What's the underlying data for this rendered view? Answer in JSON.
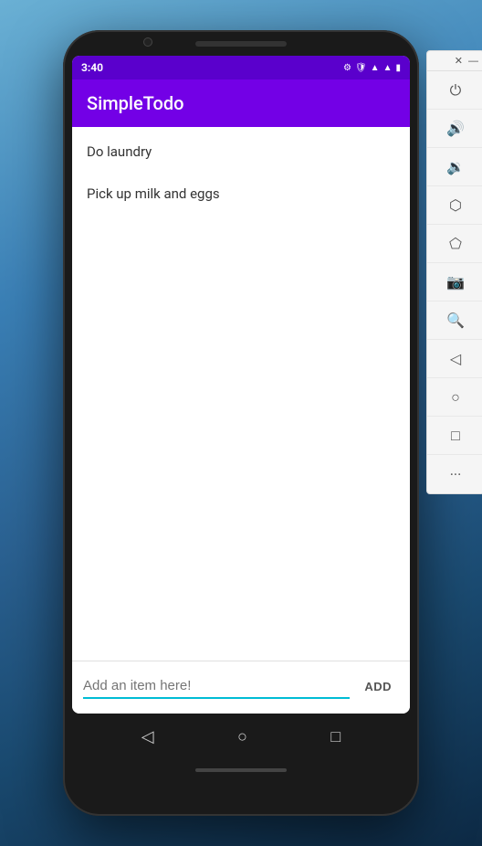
{
  "status_bar": {
    "time": "3:40",
    "icons": [
      "⚙",
      "🛡",
      "🔋"
    ]
  },
  "app_toolbar": {
    "title": "SimpleTodo"
  },
  "todo_items": [
    {
      "id": 1,
      "text": "Do laundry"
    },
    {
      "id": 2,
      "text": "Pick up milk and eggs"
    }
  ],
  "input": {
    "placeholder": "Add an item here!",
    "value": ""
  },
  "add_button": {
    "label": "ADD"
  },
  "nav_icons": [
    "◁",
    "○",
    "□"
  ],
  "side_panel": {
    "close": "✕",
    "minimize": "—",
    "items": [
      {
        "name": "power-icon",
        "symbol": "⏻"
      },
      {
        "name": "volume-up-icon",
        "symbol": "🔊"
      },
      {
        "name": "volume-down-icon",
        "symbol": "🔉"
      },
      {
        "name": "eraser-icon",
        "symbol": "◈"
      },
      {
        "name": "tag-icon",
        "symbol": "◇"
      },
      {
        "name": "camera-icon",
        "symbol": "📷"
      },
      {
        "name": "zoom-in-icon",
        "symbol": "🔍"
      },
      {
        "name": "back-icon",
        "symbol": "◁"
      },
      {
        "name": "home-icon",
        "symbol": "○"
      },
      {
        "name": "recent-icon",
        "symbol": "□"
      },
      {
        "name": "more-icon",
        "symbol": "···"
      }
    ]
  }
}
